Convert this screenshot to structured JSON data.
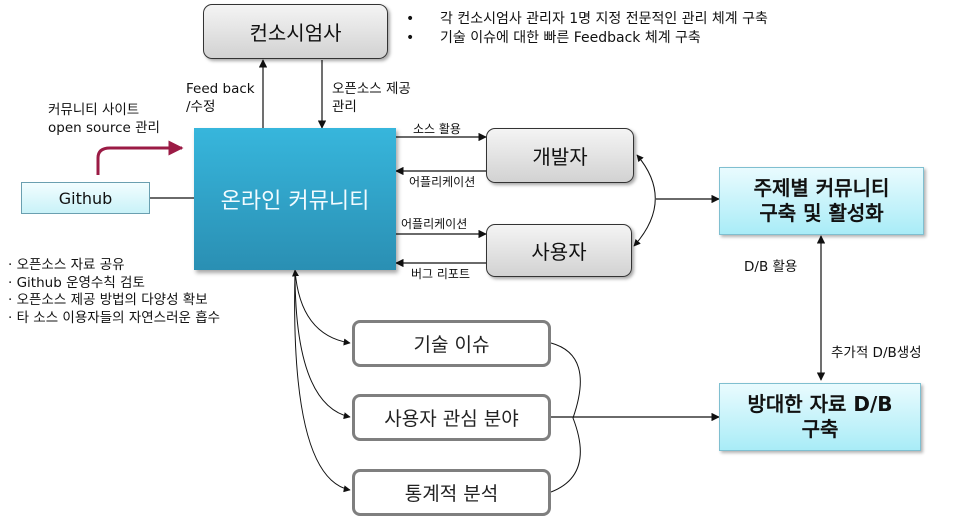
{
  "nodes": {
    "consortium": "컨소시엄사",
    "online_community": "온라인 커뮤니티",
    "developer": "개발자",
    "user": "사용자",
    "github": "Github",
    "topic_community": [
      "주제별 커뮤니티",
      "구축 및 활성화"
    ],
    "large_db": [
      "방대한 자료 D/B",
      "구축"
    ],
    "tech_issue": "기술 이슈",
    "user_interest": "사용자 관심 분야",
    "statistics": "통계적 분석"
  },
  "consortium_notes": [
    "각 컨소시엄사 관리자 1명 지정 전문적인 관리 체계 구축",
    "기술 이슈에 대한 빠른 Feedback 체계 구축"
  ],
  "github_notes": [
    "오픈소스 자료 공유",
    "Github 운영수칙 검토",
    "오픈소스 제공 방법의 다양성 확보",
    "타 소스 이용자들의 자연스러운 흡수"
  ],
  "edge_labels": {
    "feedback": [
      "Feed back",
      "/수정"
    ],
    "open_source_provide": [
      "오픈소스 제공",
      "관리"
    ],
    "community_site": [
      "커뮤니티 사이트",
      "open source 관리"
    ],
    "source_use": "소스 활용",
    "application_to_community": "어플리케이션",
    "application_to_user": "어플리케이션",
    "bug_report": "버그 리포트",
    "db_use": "D/B 활용",
    "additional_db": "추가적 D/B생성"
  },
  "colors": {
    "main_box": "#2fa3c9",
    "highlight_arrow": "#9b1b45",
    "cyan_box": "#bff2fa"
  }
}
